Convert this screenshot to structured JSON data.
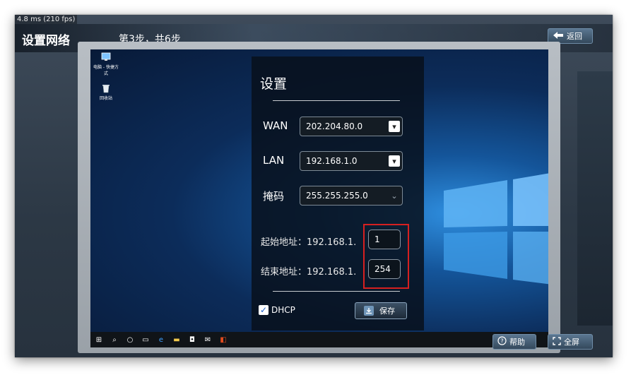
{
  "hud": {
    "fps": "4.8 ms (210 fps)",
    "title": "设置网络",
    "step": "第3步，共6步",
    "back_label": "返回",
    "help_label": "帮助",
    "fullscreen_label": "全屏"
  },
  "settings": {
    "title": "设置",
    "wan_label": "WAN",
    "wan_value": "202.204.80.0",
    "lan_label": "LAN",
    "lan_value": "192.168.1.0",
    "mask_label": "掩码",
    "mask_value": "255.255.255.0",
    "start_label": "起始地址：192.168.1.",
    "start_value": "1",
    "end_label": "结束地址：192.168.1.",
    "end_value": "254",
    "dhcp_label": "DHCP",
    "dhcp_checked": true,
    "save_label": "保存"
  },
  "desktop": {
    "icons": [
      {
        "label": "电脑 - 快捷方式",
        "icon": "computer-icon"
      },
      {
        "label": "回收站",
        "icon": "recycle-bin-icon"
      }
    ]
  },
  "colors": {
    "highlight_box": "#d62020",
    "panel_bg": "#08101c"
  }
}
